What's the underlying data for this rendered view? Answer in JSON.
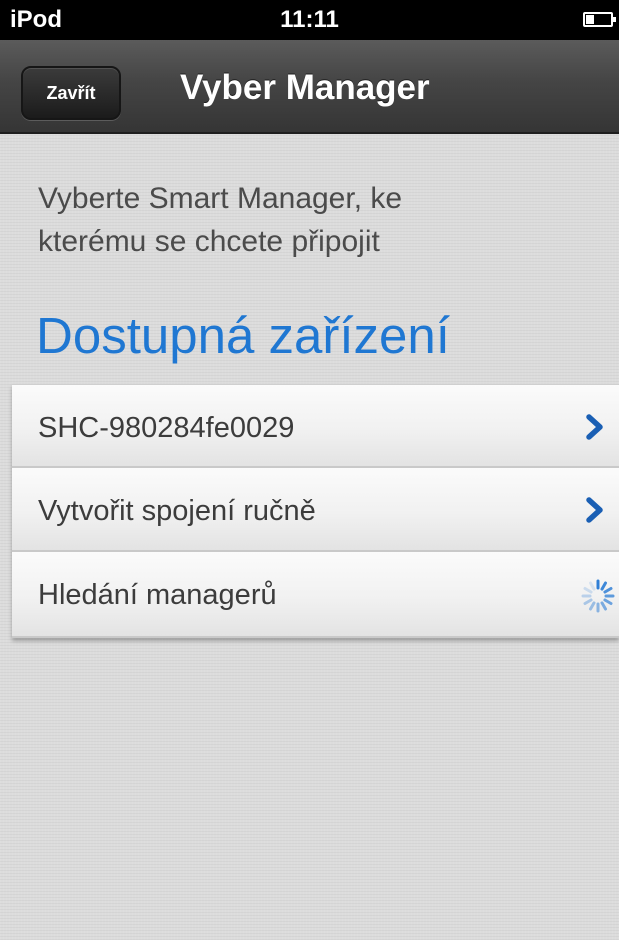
{
  "status_bar": {
    "carrier": "iPod",
    "time": "11:11"
  },
  "nav": {
    "close_label": "Zavřít",
    "title": "Vyber Manager"
  },
  "content": {
    "instruction_line1": "Vyberte Smart Manager, ke",
    "instruction_line2": "kterému se chcete připojit",
    "section_title": "Dostupná zařízení"
  },
  "list": {
    "items": [
      {
        "label": "SHC-980284fe0029",
        "icon": "chevron-right-icon"
      },
      {
        "label": "Vytvořit spojení ručně",
        "icon": "chevron-right-icon"
      },
      {
        "label": "Hledání managerů",
        "icon": "loading-spinner-icon"
      }
    ]
  },
  "colors": {
    "accent_blue": "#1f77d2",
    "chevron_blue": "#1a5fb4",
    "nav_bar": "#454545",
    "background": "#dcdcdc"
  }
}
